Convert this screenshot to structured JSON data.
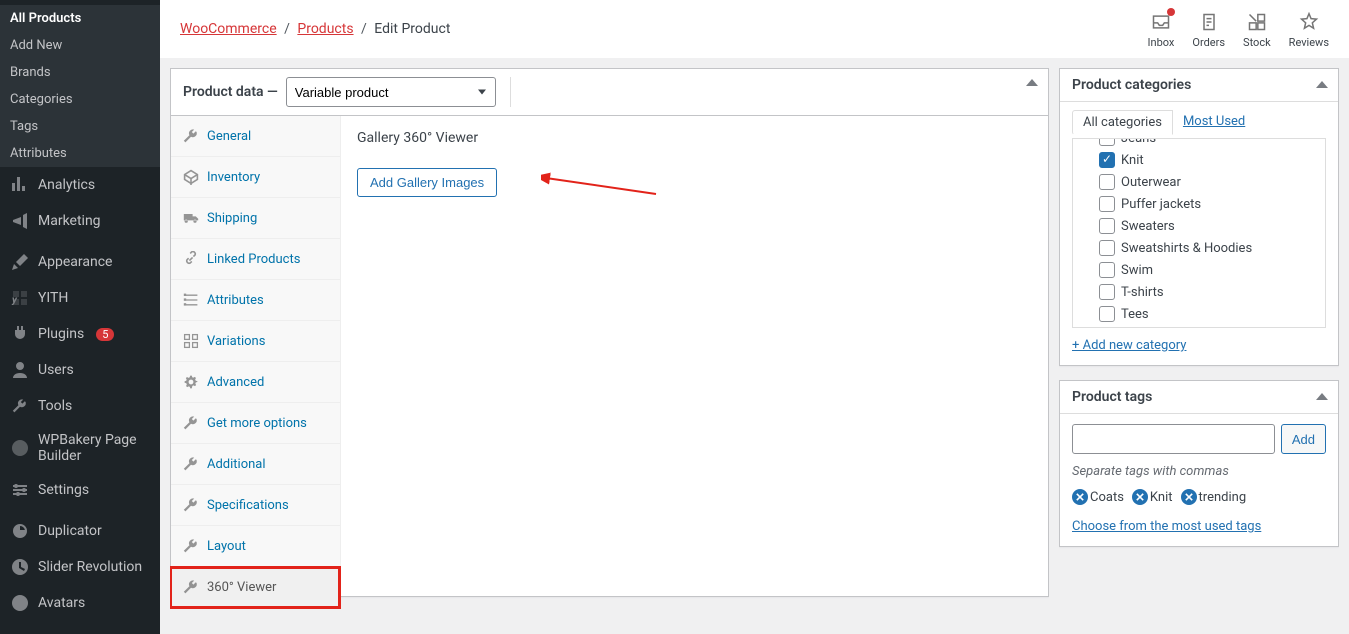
{
  "sidebar": {
    "products_submenu": [
      {
        "label": "All Products",
        "current": true
      },
      {
        "label": "Add New"
      },
      {
        "label": "Brands"
      },
      {
        "label": "Categories"
      },
      {
        "label": "Tags"
      },
      {
        "label": "Attributes"
      }
    ],
    "items": [
      {
        "label": "Analytics",
        "icon": "analytics"
      },
      {
        "label": "Marketing",
        "icon": "megaphone"
      },
      {
        "sep": true
      },
      {
        "label": "Appearance",
        "icon": "brush"
      },
      {
        "label": "YITH",
        "icon": "yith"
      },
      {
        "label": "Plugins",
        "icon": "plug",
        "count": "5"
      },
      {
        "label": "Users",
        "icon": "user"
      },
      {
        "label": "Tools",
        "icon": "wrench"
      },
      {
        "label": "WPBakery Page Builder",
        "icon": "wpb"
      },
      {
        "label": "Settings",
        "icon": "settings"
      },
      {
        "sep": true
      },
      {
        "label": "Duplicator",
        "icon": "duplicator"
      },
      {
        "label": "Slider Revolution",
        "icon": "slider"
      },
      {
        "label": "Avatars",
        "icon": "avatar"
      }
    ]
  },
  "breadcrumbs": {
    "woo": "WooCommerce",
    "products": "Products",
    "current": "Edit Product"
  },
  "header_actions": {
    "inbox": "Inbox",
    "orders": "Orders",
    "stock": "Stock",
    "reviews": "Reviews"
  },
  "product_data": {
    "title": "Product data —",
    "selected_type": "Variable product",
    "tabs": [
      {
        "label": "General",
        "icon": "wrench"
      },
      {
        "label": "Inventory",
        "icon": "inventory"
      },
      {
        "label": "Shipping",
        "icon": "truck"
      },
      {
        "label": "Linked Products",
        "icon": "link"
      },
      {
        "label": "Attributes",
        "icon": "attributes"
      },
      {
        "label": "Variations",
        "icon": "variations"
      },
      {
        "label": "Advanced",
        "icon": "gear"
      },
      {
        "label": "Get more options",
        "icon": "wrench"
      },
      {
        "label": "Additional",
        "icon": "wrench"
      },
      {
        "label": "Specifications",
        "icon": "wrench"
      },
      {
        "label": "Layout",
        "icon": "wrench"
      },
      {
        "label": "360° Viewer",
        "icon": "wrench",
        "active": true,
        "highlighted": true
      }
    ],
    "content": {
      "heading": "Gallery 360° Viewer",
      "button": "Add Gallery Images"
    }
  },
  "categories": {
    "title": "Product categories",
    "tab_all": "All categories",
    "tab_most_used": "Most Used",
    "items": [
      {
        "label": "Jeans",
        "checked": false,
        "obscured": true
      },
      {
        "label": "Knit",
        "checked": true
      },
      {
        "label": "Outerwear",
        "checked": false
      },
      {
        "label": "Puffer jackets",
        "checked": false
      },
      {
        "label": "Sweaters",
        "checked": false
      },
      {
        "label": "Sweatshirts & Hoodies",
        "checked": false
      },
      {
        "label": "Swim",
        "checked": false
      },
      {
        "label": "T-shirts",
        "checked": false
      },
      {
        "label": "Tees",
        "checked": false
      }
    ],
    "add_new": "+ Add new category"
  },
  "tags": {
    "title": "Product tags",
    "add_button": "Add",
    "hint": "Separate tags with commas",
    "chips": [
      "Coats",
      "Knit",
      "trending"
    ],
    "choose_link": "Choose from the most used tags"
  }
}
